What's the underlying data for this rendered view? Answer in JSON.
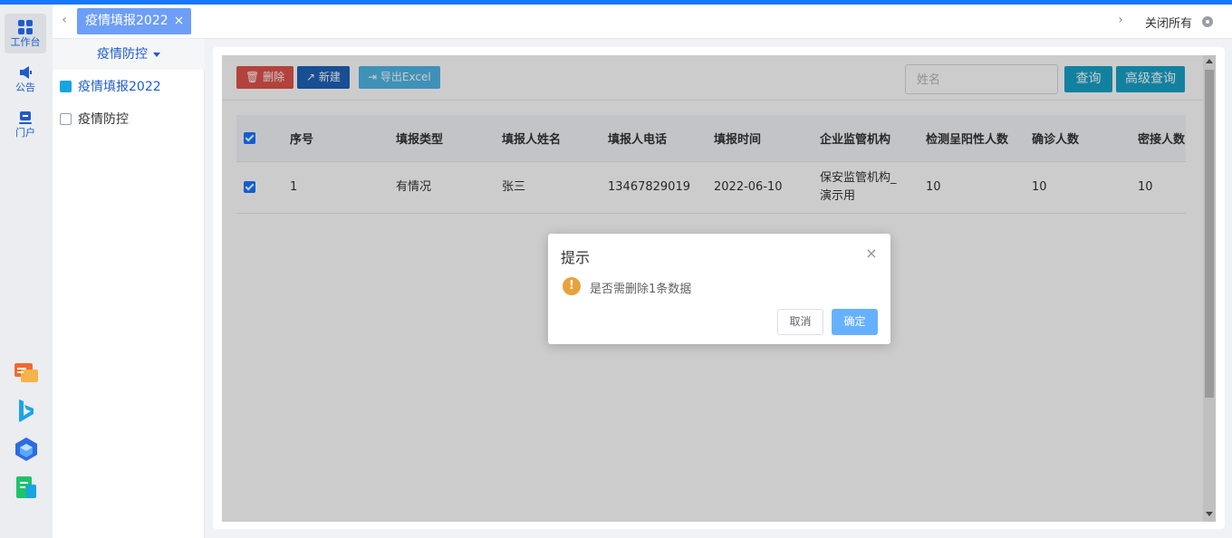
{
  "rail": {
    "items": [
      {
        "label": "工作台",
        "icon": "grid-icon"
      },
      {
        "label": "公告",
        "icon": "megaphone-icon"
      },
      {
        "label": "门户",
        "icon": "portal-icon"
      }
    ],
    "apps": [
      "chat-app-icon",
      "bing-app-icon",
      "cube-app-icon",
      "doc-app-icon"
    ]
  },
  "tabs": {
    "active_label": "疫情填报2022",
    "close_glyph": "×",
    "prev_glyph": "‹",
    "next_glyph": "›",
    "close_all": "关闭所有"
  },
  "subnav": {
    "header": "疫情防控",
    "items": [
      {
        "label": "疫情填报2022",
        "active": true
      },
      {
        "label": "疫情防控",
        "active": false
      }
    ]
  },
  "toolbar": {
    "delete_label": "删除",
    "new_label": "新建",
    "export_label": "导出Excel",
    "search_placeholder": "姓名",
    "query_label": "查询",
    "advanced_label": "高级查询"
  },
  "table": {
    "headers": [
      "序号",
      "填报类型",
      "填报人姓名",
      "填报人电话",
      "填报时间",
      "企业监管机构",
      "检测呈阳性人数",
      "确诊人数",
      "密接人数"
    ],
    "rows": [
      {
        "checked": true,
        "cells": [
          "1",
          "有情况",
          "张三",
          "13467829019",
          "2022-06-10",
          "保安监管机构_演示用",
          "10",
          "10",
          "10"
        ]
      }
    ]
  },
  "dialog": {
    "title": "提示",
    "message": "是否需删除1条数据",
    "warn_glyph": "!",
    "close_glyph": "×",
    "cancel_label": "取消",
    "ok_label": "确定"
  },
  "colors": {
    "accent": "#1677ff",
    "delete": "#e0534b",
    "new": "#1e62b8",
    "export": "#4fb6e6",
    "query": "#17a2c9",
    "warning": "#e6a23c",
    "confirm": "#66b1ff"
  }
}
